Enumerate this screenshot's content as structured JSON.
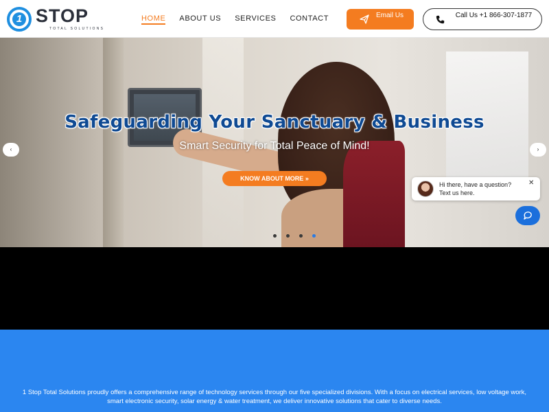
{
  "brand": {
    "logo_number": "1",
    "logo_word": "STOP",
    "logo_subtitle": "TOTAL SOLUTIONS"
  },
  "nav": {
    "items": [
      {
        "label": "HOME",
        "active": true
      },
      {
        "label": "ABOUT US",
        "active": false
      },
      {
        "label": "SERVICES",
        "active": false
      },
      {
        "label": "CONTACT",
        "active": false
      }
    ]
  },
  "header_actions": {
    "email_label": "Email Us",
    "call_label": "Call Us +1 866-307-1877"
  },
  "hero": {
    "title": "Safeguarding Your Sanctuary & Business",
    "subtitle": "Smart Security for Total Peace of Mind!",
    "cta_label": "KNOW ABOUT MORE »",
    "prev_arrow": "‹",
    "next_arrow": "›",
    "slide_count": 4,
    "active_slide": 4
  },
  "intro": {
    "text": "1 Stop Total Solutions proudly offers a comprehensive range of technology services through our five specialized divisions. With a focus on electrical services, low voltage work, smart electronic security, solar energy & water treatment, we deliver innovative solutions that cater to diverse needs."
  },
  "chat": {
    "message": "Hi there, have a question? Text us here.",
    "close_label": "✕"
  },
  "colors": {
    "accent_orange": "#f47c20",
    "brand_blue": "#2b86f0",
    "title_blue": "#0f4a93",
    "chat_blue": "#1b6fdc"
  }
}
